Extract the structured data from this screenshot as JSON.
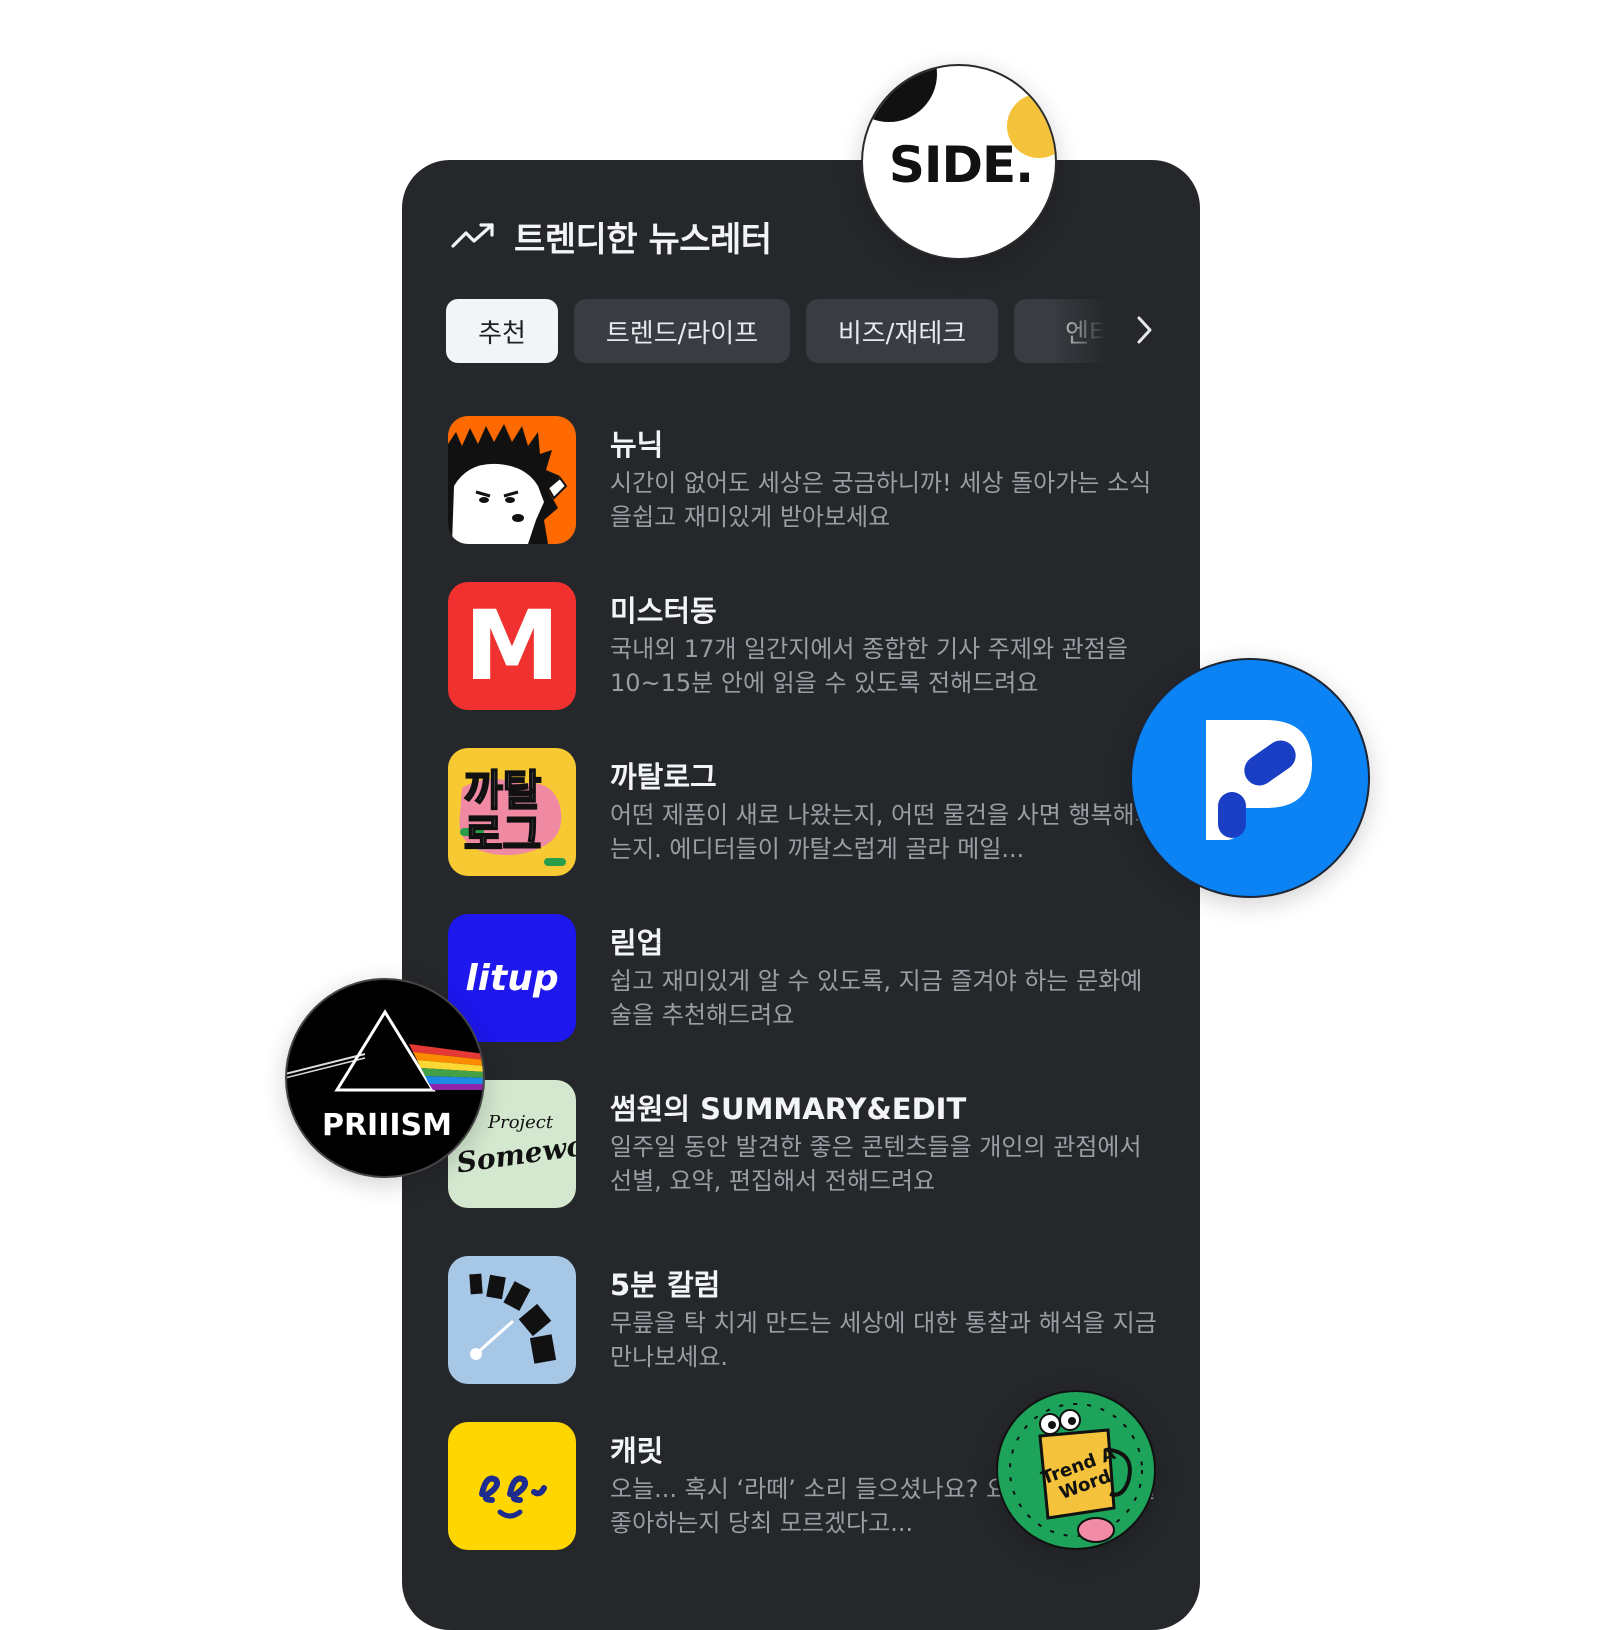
{
  "header": {
    "title": "트렌디한 뉴스레터"
  },
  "tabs": [
    "추천",
    "트렌드/라이프",
    "비즈/재테크",
    "엔터"
  ],
  "newsletters": [
    {
      "name": "뉴닉",
      "desc": "시간이 없어도 세상은 궁금하니까! 세상 돌아가는 소식을쉽고 재미있게 받아보세요"
    },
    {
      "name": "미스터동",
      "desc": "국내외 17개 일간지에서 종합한 기사 주제와 관점을 10~15분 안에 읽을 수 있도록 전해드려요"
    },
    {
      "name": "까탈로그",
      "desc": "어떤 제품이 새로 나왔는지, 어떤 물건을 사면 행복해지는지. 에디터들이 까탈스럽게 골라 메일..."
    },
    {
      "name": "릳업",
      "desc": "쉽고 재미있게 알 수 있도록, 지금 즐겨야 하는 문화예술을 추천해드려요"
    },
    {
      "name": "썸원의 SUMMARY&EDIT",
      "desc": "일주일 동안 발견한 좋은 콘텐츠들을 개인의 관점에서 선별, 요약, 편집해서 전해드려요"
    },
    {
      "name": "5분 칼럼",
      "desc": "무릎을 탁 치게 만드는 세상에 대한 통찰과 해석을 지금 만나보세요."
    },
    {
      "name": "캐릿",
      "desc": "오늘... 혹시 ‘라떼’ 소리 들으셨나요? 요즘 친구들이 뭘 좋아하는지 당최 모르겠다고..."
    }
  ],
  "logos": {
    "mister_dong": "M",
    "katalog_top": "까탈",
    "katalog_bottom": "로그",
    "litup": "litup",
    "someone_line1": "Project",
    "someone_line2": "SomewoN",
    "side": "SIDE.",
    "priism": "PRIIISM",
    "trend_word": "Trend A Word"
  },
  "colors": {
    "panel": "#25272b",
    "newneek_orange": "#ff6a00",
    "mister_red": "#f0312f",
    "katalog_yellow": "#f7c933",
    "litup_blue": "#1e17ee",
    "someone_green": "#d3e8cf",
    "column_blue": "#a7c7e7",
    "careet_yellow": "#ffd600",
    "pp_blue": "#0b83f5",
    "trend_green": "#1ea35a"
  },
  "icons": [
    "trending-up-icon",
    "chevron-right-icon"
  ]
}
